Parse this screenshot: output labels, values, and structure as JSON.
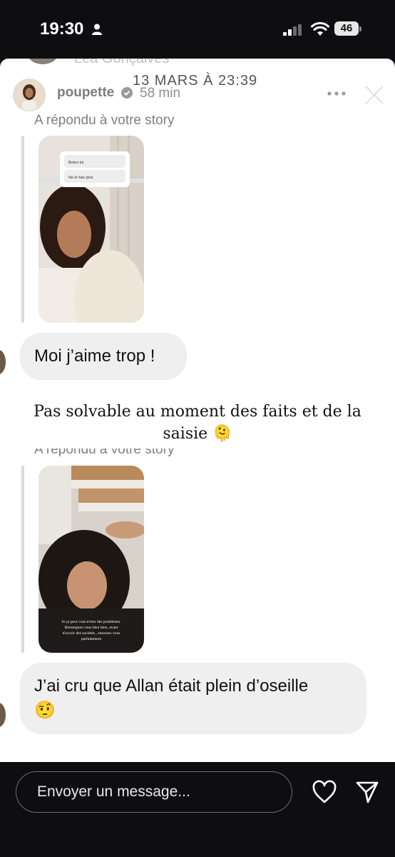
{
  "status_bar": {
    "time": "19:30",
    "battery": "46"
  },
  "story": {
    "ghost_name": "Lea Gonçalves",
    "ghost_date": "13 MARS À 23:39",
    "username": "poupette",
    "elapsed": "58 min"
  },
  "messages": [
    {
      "reply_label": "A répondu à votre story",
      "poll_options": [
        "Botox toi",
        "Ne le fais plus"
      ],
      "text": "Moi j’aime trop !"
    },
    {
      "reply_label": "A répondu à votre story",
      "story_caption": "Si ça peut vous éviter des problèmes. Renseignez vous bien bien, avant d'ouvrir des sociétés , entourez vous parfaitement",
      "text": "J’ai cru que Allan était plein d’oseille",
      "emoji": "🤨"
    }
  ],
  "caption": {
    "text": "Pas solvable au moment des faits et de la saisie",
    "emoji": "🫠"
  },
  "composer": {
    "placeholder": "Envoyer un message..."
  },
  "icons": [
    "person-icon",
    "signal-icon",
    "wifi-icon",
    "battery-icon",
    "verified-icon",
    "more-icon",
    "close-icon",
    "heart-icon",
    "send-icon"
  ]
}
